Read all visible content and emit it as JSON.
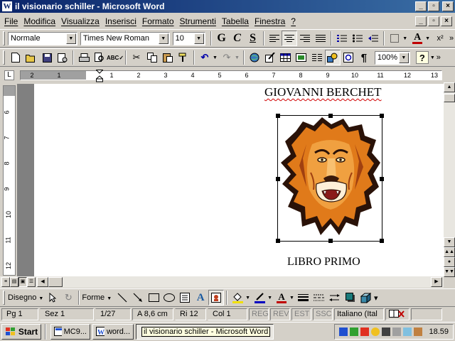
{
  "window": {
    "title": "il visionario schiller - Microsoft Word",
    "app_icon": "W",
    "minimize": "_",
    "maximize": "▫",
    "close": "×"
  },
  "menu": {
    "items": [
      "File",
      "Modifica",
      "Visualizza",
      "Inserisci",
      "Formato",
      "Strumenti",
      "Tabella",
      "Finestra",
      "?"
    ]
  },
  "format_toolbar": {
    "style": "Normale",
    "font": "Times New Roman",
    "size": "10",
    "bold": "G",
    "italic": "C",
    "underline": "S",
    "font_color_letter": "A",
    "superscript": "x²",
    "more": "»"
  },
  "standard_toolbar": {
    "zoom": "100%",
    "help": "?",
    "pilcrow": "¶",
    "more": "»"
  },
  "ruler": {
    "tab_selector": "L",
    "numbers": [
      "2",
      "1",
      "1",
      "2",
      "3",
      "4",
      "5",
      "6",
      "7",
      "8",
      "9",
      "10",
      "11",
      "12",
      "13"
    ]
  },
  "vertical_ruler": {
    "numbers": [
      "6",
      "7",
      "8",
      "9",
      "10",
      "11",
      "12"
    ]
  },
  "document": {
    "title": "GIOVANNI BERCHET",
    "subtitle": "LIBRO PRIMO",
    "image": "lion-head-clipart"
  },
  "drawing_toolbar": {
    "draw_menu": "Disegno",
    "autoshapes_menu": "Forme",
    "font_color_letter": "A"
  },
  "status": {
    "page": "Pg 1",
    "section": "Sez 1",
    "page_count": "1/27",
    "position": "A  8,6 cm",
    "line": "Ri  12",
    "column": "Col  1",
    "rec": "REG",
    "rev": "REV",
    "ext": "EST",
    "ovr": "SSC",
    "language": "Italiano (Ital"
  },
  "taskbar": {
    "start": "Start",
    "tasks": [
      "MC9...",
      "word...",
      "il visionario schiller - Microsoft Word"
    ],
    "clock": "18.59"
  },
  "colors": {
    "titlebar_start": "#0a246a",
    "titlebar_end": "#3a6ea5",
    "spell_underline": "#d00000",
    "lion_mane": "#e07a1a",
    "lion_face": "#f0a040"
  }
}
